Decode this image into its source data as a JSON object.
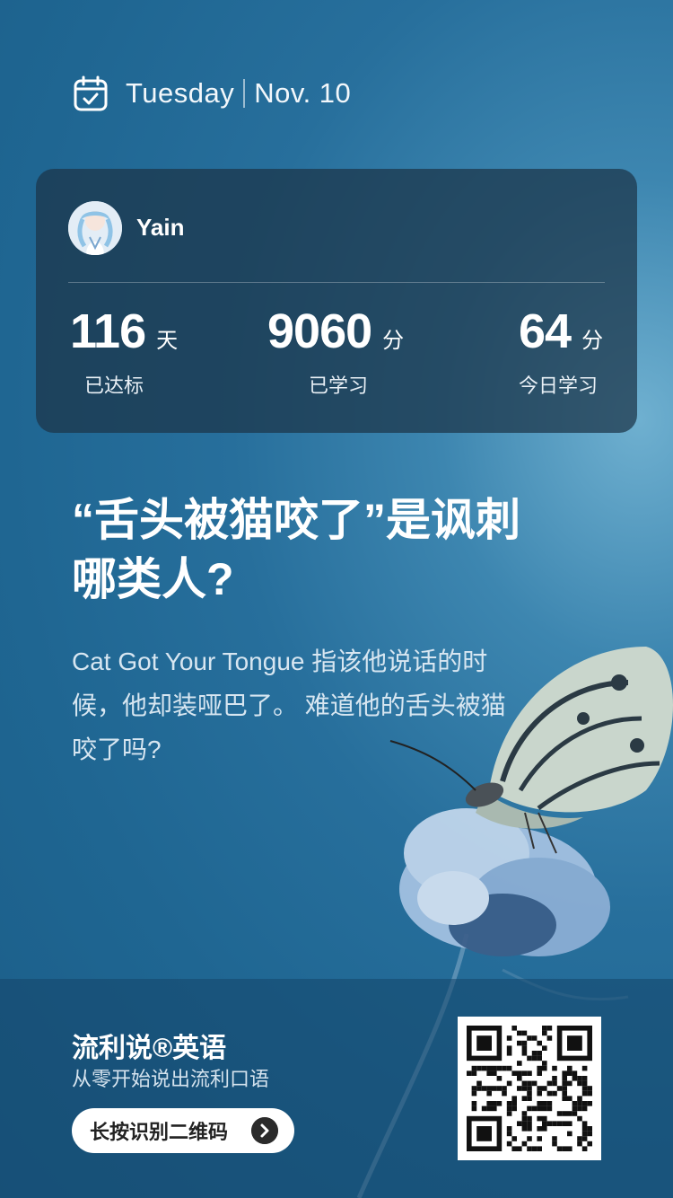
{
  "header": {
    "weekday": "Tuesday",
    "date": "Nov. 10"
  },
  "profile": {
    "username": "Yain"
  },
  "stats": [
    {
      "value": "116",
      "unit": "天",
      "label": "已达标"
    },
    {
      "value": "9060",
      "unit": "分",
      "label": "已学习"
    },
    {
      "value": "64",
      "unit": "分",
      "label": "今日学习"
    }
  ],
  "article": {
    "headline": "“舌头被猫咬了”是讽刺哪类人?",
    "description": "Cat Got Your Tongue 指该他说话的时候，他却装哑巴了。 难道他的舌头被猫咬了吗?"
  },
  "footer": {
    "brand": "流利说®英语",
    "slogan": "从零开始说出流利口语",
    "qr_button_label": "长按识别二维码"
  },
  "icons": {
    "calendar": "calendar-check-icon",
    "arrow": "chevron-right-icon",
    "qr": "qr-code"
  },
  "colors": {
    "background": "#1f6692",
    "card": "#1c3448"
  }
}
